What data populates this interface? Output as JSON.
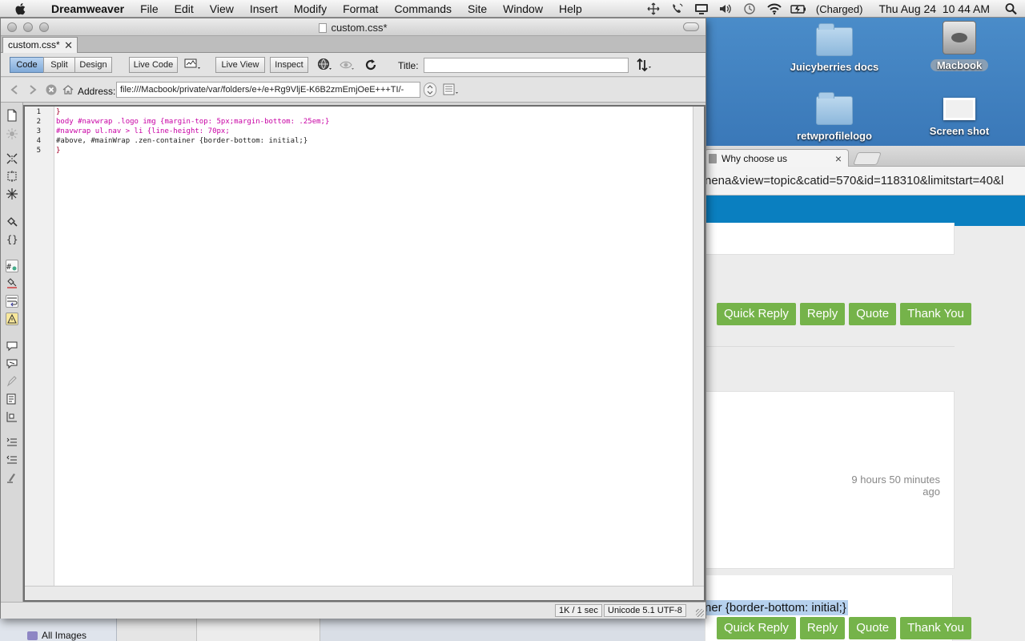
{
  "menubar": {
    "app": "Dreamweaver",
    "items": [
      "File",
      "Edit",
      "View",
      "Insert",
      "Modify",
      "Format",
      "Commands",
      "Site",
      "Window",
      "Help"
    ],
    "battery_status": "(Charged)",
    "clock": "Thu Aug 24  10 44 AM"
  },
  "desktop": {
    "icons": [
      {
        "label": "Juicyberries docs",
        "type": "folder"
      },
      {
        "label": "Macbook",
        "type": "hard-drive"
      },
      {
        "label": "retwprofilelogo",
        "type": "folder"
      },
      {
        "label": "Screen shot",
        "type": "image"
      }
    ]
  },
  "browser": {
    "tab_title": "Why choose us",
    "url_fragment": "nena&view=topic&catid=570&id=118310&limitstart=40&l",
    "buttons": [
      "Quick Reply",
      "Reply",
      "Quote",
      "Thank You"
    ],
    "time_ago": "9 hours 50 minutes ago",
    "selected_text": "ner {border-bottom: initial;}"
  },
  "finder": {
    "sidebar_item": "All Images"
  },
  "dreamweaver": {
    "window_title": "custom.css*",
    "doc_tab": "custom.css*",
    "view_buttons": [
      "Code",
      "Split",
      "Design"
    ],
    "active_view": "Code",
    "live_code": "Live Code",
    "live_view": "Live View",
    "inspect": "Inspect",
    "title_label": "Title:",
    "title_value": "",
    "address_label": "Address:",
    "address_value": "file:///Macbook/private/var/folders/e+/e+Rg9VljE-K6B2zmEmjOeE+++TI/-",
    "code_lines": [
      {
        "n": "1",
        "text": "}"
      },
      {
        "n": "2",
        "text": "body #navwrap .logo img {margin-top: 5px;margin-bottom: .25em;}"
      },
      {
        "n": "3",
        "text": "#navwrap ul.nav > li {line-height: 70px;"
      },
      {
        "n": "4",
        "text": "#above, #mainWrap .zen-container {border-bottom: initial;}"
      },
      {
        "n": "5",
        "text": "}"
      }
    ],
    "status_size": "1K / 1 sec",
    "status_encoding": "Unicode 5.1 UTF-8"
  }
}
